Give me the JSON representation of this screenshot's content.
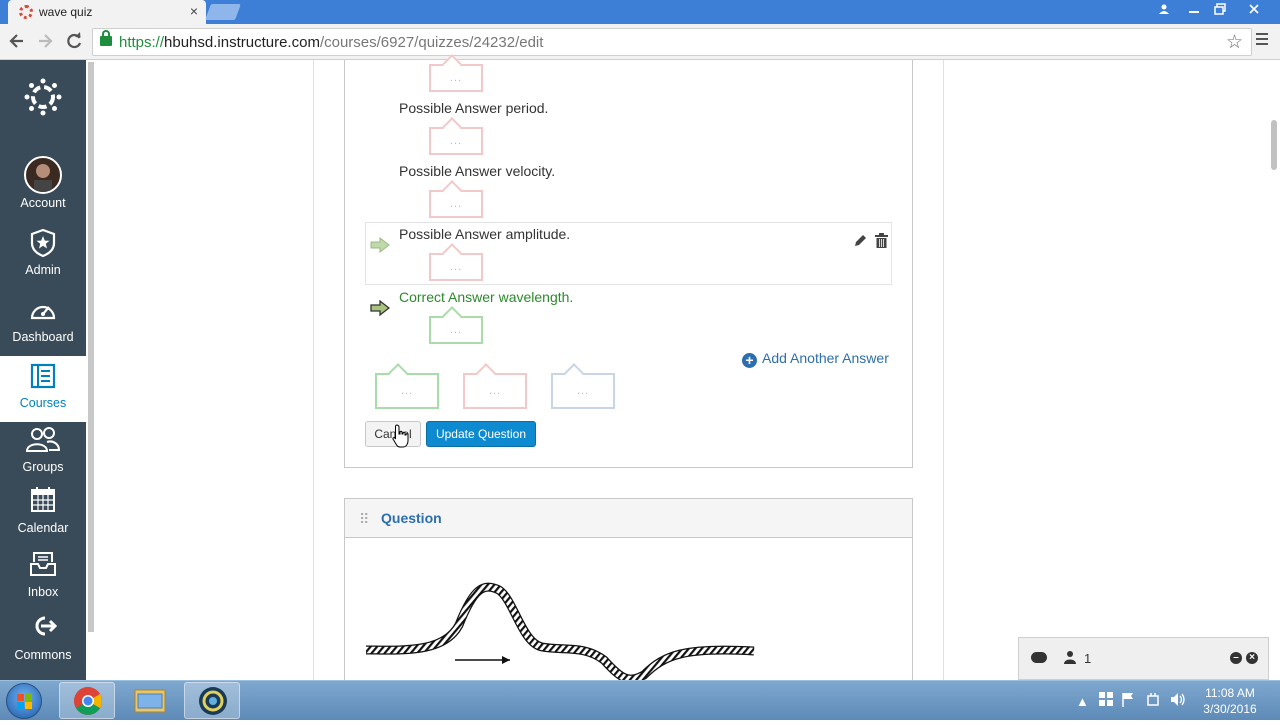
{
  "browser": {
    "tab_title": "wave quiz",
    "tab_close": "×",
    "url_scheme": "https://",
    "url_host": "hbuhsd.instructure.com",
    "url_path": "/courses/6927/quizzes/24232/edit",
    "window_controls": [
      "person-icon",
      "minimize-icon",
      "restore-icon",
      "close-icon"
    ]
  },
  "leftnav": {
    "items": [
      {
        "label": "Account",
        "icon": "avatar"
      },
      {
        "label": "Admin",
        "icon": "shield-star-icon"
      },
      {
        "label": "Dashboard",
        "icon": "gauge-icon"
      },
      {
        "label": "Courses",
        "icon": "book-icon",
        "active": true
      },
      {
        "label": "Groups",
        "icon": "users-icon"
      },
      {
        "label": "Calendar",
        "icon": "calendar-icon"
      },
      {
        "label": "Inbox",
        "icon": "inbox-icon"
      },
      {
        "label": "Commons",
        "icon": "commons-icon"
      }
    ]
  },
  "question_editor": {
    "answers": [
      {
        "text": "Possible Answer period.",
        "correct": false
      },
      {
        "text": "Possible Answer velocity.",
        "correct": false
      },
      {
        "text": "Possible Answer amplitude.",
        "correct": false
      },
      {
        "text": "Correct Answer wavelength.",
        "correct": true
      }
    ],
    "comment_placeholder": "...",
    "add_answer_label": "Add Another Answer",
    "cancel_label": "Cancel",
    "update_label": "Update Question"
  },
  "next_question": {
    "title": "Question",
    "drag_handle": "⠿"
  },
  "chat": {
    "online_count": "1"
  },
  "taskbar": {
    "time": "11:08 AM",
    "date": "3/30/2016"
  },
  "colors": {
    "nav_bg": "#394b58",
    "accent_blue": "#0e8bd0",
    "correct_green": "#2c8a2c",
    "link_blue": "#2d6eae"
  }
}
